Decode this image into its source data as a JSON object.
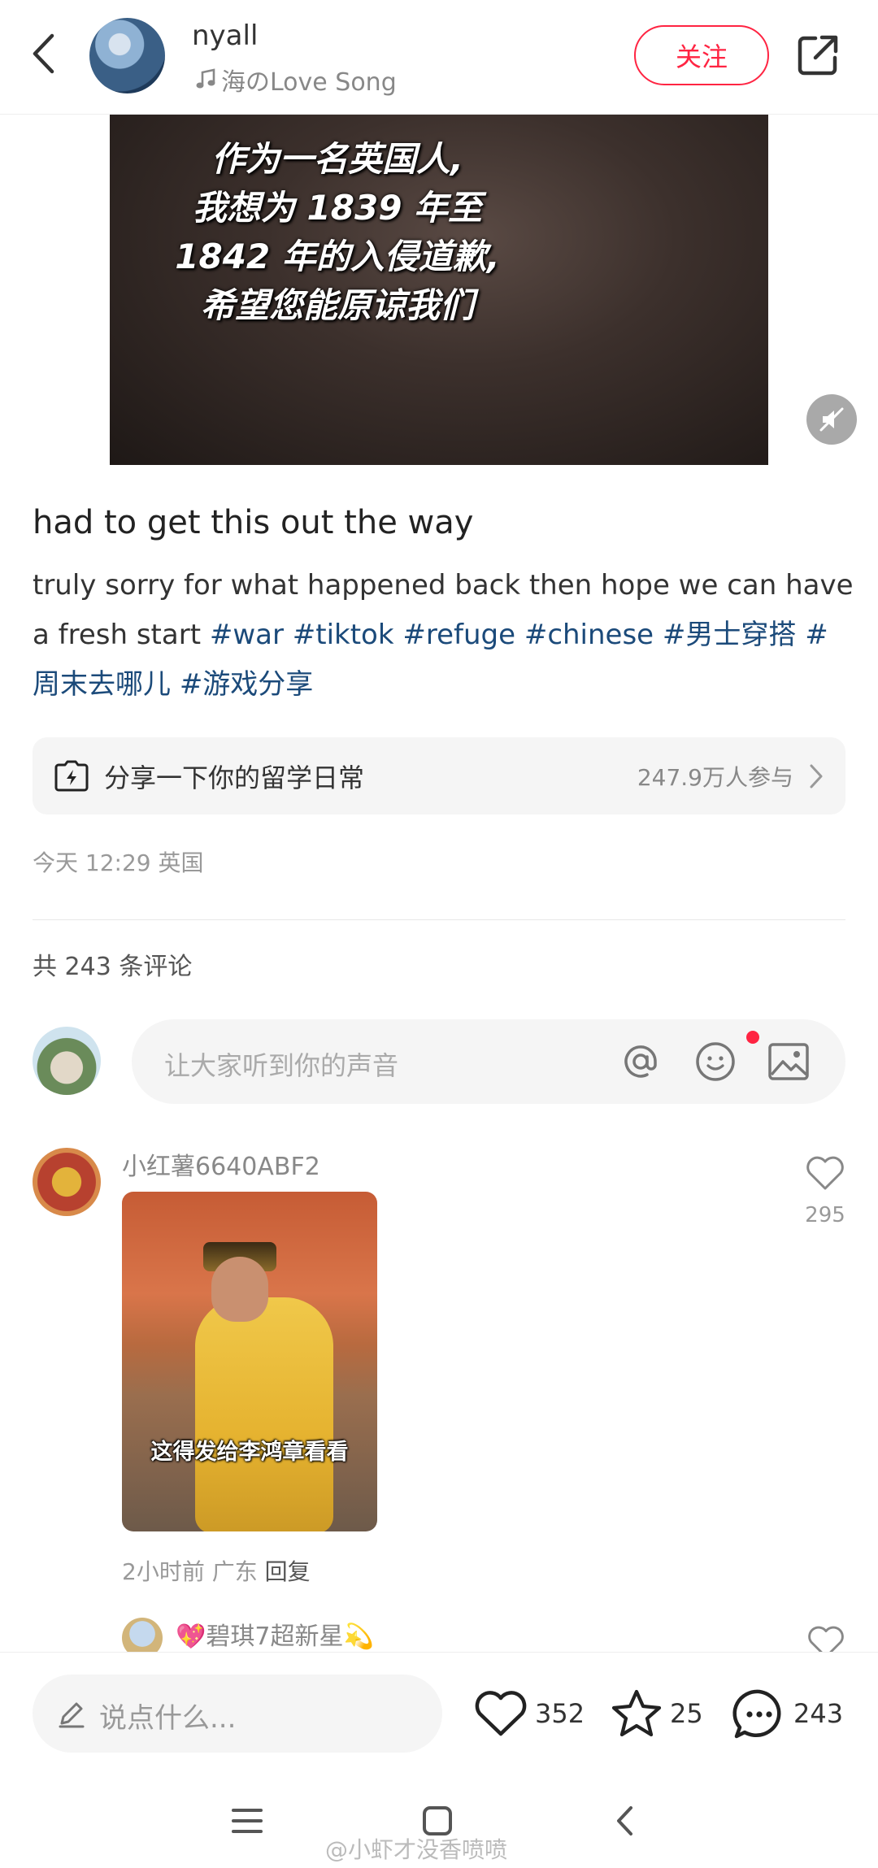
{
  "header": {
    "author": "nyall",
    "music": "海のLove Song",
    "follow_label": "关注"
  },
  "video": {
    "caption_lines": [
      "作为一名英国人,",
      "我想为 1839 年至",
      "1842 年的入侵道歉,",
      "希望您能原谅我们"
    ]
  },
  "post": {
    "title": "had to get this out the way",
    "body_text": "truly sorry for what happened back then hope we can have a fresh start",
    "tags": [
      "#war",
      "#tiktok",
      "#refuge",
      "#chinese",
      "#男士穿搭",
      "#周末去哪儿",
      "#游戏分享"
    ],
    "meta": "今天 12:29 英国"
  },
  "topic": {
    "label": "分享一下你的留学日常",
    "count": "247.9万人参与"
  },
  "comments_section": {
    "count_label": "共 243 条评论",
    "input_placeholder": "让大家听到你的声音"
  },
  "comments": [
    {
      "username": "小红薯6640ABF2",
      "likes": "295",
      "image_caption": "这得发给李鸿章看看",
      "time": "2小时前",
      "location": "广东",
      "reply_label": "回复"
    }
  ],
  "sub_comment": {
    "username": "💖碧琪7超新星💫"
  },
  "bottom_bar": {
    "say_placeholder": "说点什么...",
    "likes": "352",
    "stars": "25",
    "comments": "243"
  },
  "watermark": "@小虾才没香喷喷",
  "colors": {
    "accent": "#ff2442",
    "tag": "#1b4a7a"
  }
}
